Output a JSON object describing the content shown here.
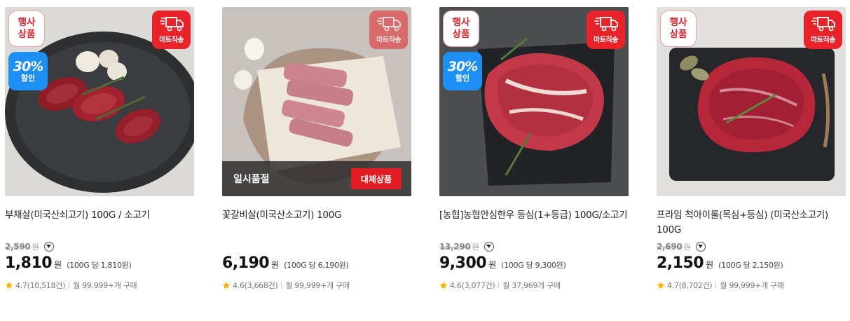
{
  "badges": {
    "event_line1": "행사",
    "event_line2": "상품",
    "ship_label": "마트직송",
    "sale_pct": "30%",
    "sale_text": "할인"
  },
  "currency_unit": "원",
  "products": [
    {
      "name": "부채살(미국산쇠고기) 100G / 소고기",
      "original_price": "2,590",
      "price": "1,810",
      "unit_price": "(100G 당 1,810원)",
      "rating": "4.7(10,518건)",
      "purchases": "월 99,999+개 구매"
    },
    {
      "name": "꽃갈비살(미국산소고기) 100G",
      "soldout_text": "일시품절",
      "substitute_label": "대체상품",
      "price": "6,190",
      "unit_price": "(100G 당 6,190원)",
      "rating": "4.6(3,668건)",
      "purchases": "월 99,999+개 구매"
    },
    {
      "name": "[농협]농협안심한우 등심(1+등급) 100G/소고기",
      "original_price": "13,290",
      "price": "9,300",
      "unit_price": "(100G 당 9,300원)",
      "rating": "4.6(3,077건)",
      "purchases": "월 37,969개 구매"
    },
    {
      "name": "프라임 척아이롤(목심+등심) (미국산소고기) 100G",
      "original_price": "2,690",
      "price": "2,150",
      "unit_price": "(100G 당 2,150원)",
      "rating": "4.7(8,702건)",
      "purchases": "월 99,999+개 구매"
    }
  ],
  "icons": {
    "truck": "truck-icon",
    "star": "star-icon",
    "dropdown": "chevron-down-icon"
  },
  "colors": {
    "brand_red": "#e8232a",
    "sale_blue": "#1e8ff5",
    "star": "#f5b400"
  }
}
